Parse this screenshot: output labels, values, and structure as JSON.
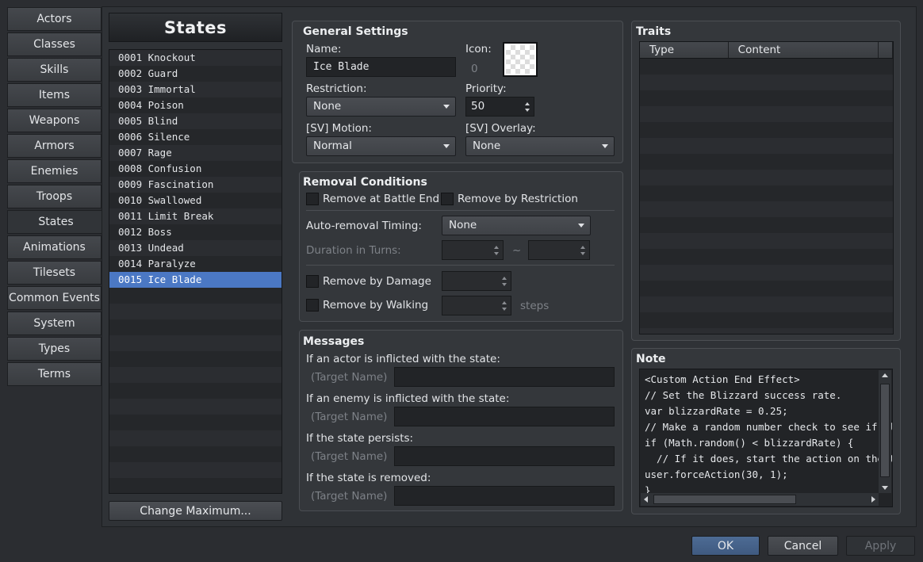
{
  "categories": [
    "Actors",
    "Classes",
    "Skills",
    "Items",
    "Weapons",
    "Armors",
    "Enemies",
    "Troops",
    "States",
    "Animations",
    "Tilesets",
    "Common Events",
    "System",
    "Types",
    "Terms"
  ],
  "active_category": "States",
  "list": {
    "title": "States",
    "items": [
      "0001 Knockout",
      "0002 Guard",
      "0003 Immortal",
      "0004 Poison",
      "0005 Blind",
      "0006 Silence",
      "0007 Rage",
      "0008 Confusion",
      "0009 Fascination",
      "0010 Swallowed",
      "0011 Limit Break",
      "0012 Boss",
      "0013 Undead",
      "0014 Paralyze",
      "0015 Ice Blade"
    ],
    "selected": "0015 Ice Blade",
    "change_max_label": "Change Maximum..."
  },
  "general": {
    "title": "General Settings",
    "name_label": "Name:",
    "name_value": "Ice Blade",
    "icon_label": "Icon:",
    "icon_index": "0",
    "restriction_label": "Restriction:",
    "restriction_value": "None",
    "priority_label": "Priority:",
    "priority_value": "50",
    "motion_label": "[SV] Motion:",
    "motion_value": "Normal",
    "overlay_label": "[SV] Overlay:",
    "overlay_value": "None"
  },
  "removal": {
    "title": "Removal Conditions",
    "battle_end_label": "Remove at Battle End",
    "restriction_label": "Remove by Restriction",
    "timing_label": "Auto-removal Timing:",
    "timing_value": "None",
    "duration_label": "Duration in Turns:",
    "tilde": "~",
    "damage_label": "Remove by Damage",
    "walking_label": "Remove by Walking",
    "steps_label": "steps"
  },
  "messages": {
    "title": "Messages",
    "actor_label": "If an actor is inflicted with the state:",
    "enemy_label": "If an enemy is inflicted with the state:",
    "persists_label": "If the state persists:",
    "removed_label": "If the state is removed:",
    "target_name": "(Target Name)"
  },
  "traits": {
    "title": "Traits",
    "col_type": "Type",
    "col_content": "Content"
  },
  "note": {
    "title": "Note",
    "lines": [
      "<Custom Action End Effect>",
      "// Set the Blizzard success rate.",
      "var blizzardRate = 0.25;",
      "// Make a random number check to see if bli",
      "if (Math.random() < blizzardRate) {",
      "  // If it does, start the action on the ta",
      "user.forceAction(30, 1);",
      "}"
    ]
  },
  "footer": {
    "ok": "OK",
    "cancel": "Cancel",
    "apply": "Apply"
  }
}
